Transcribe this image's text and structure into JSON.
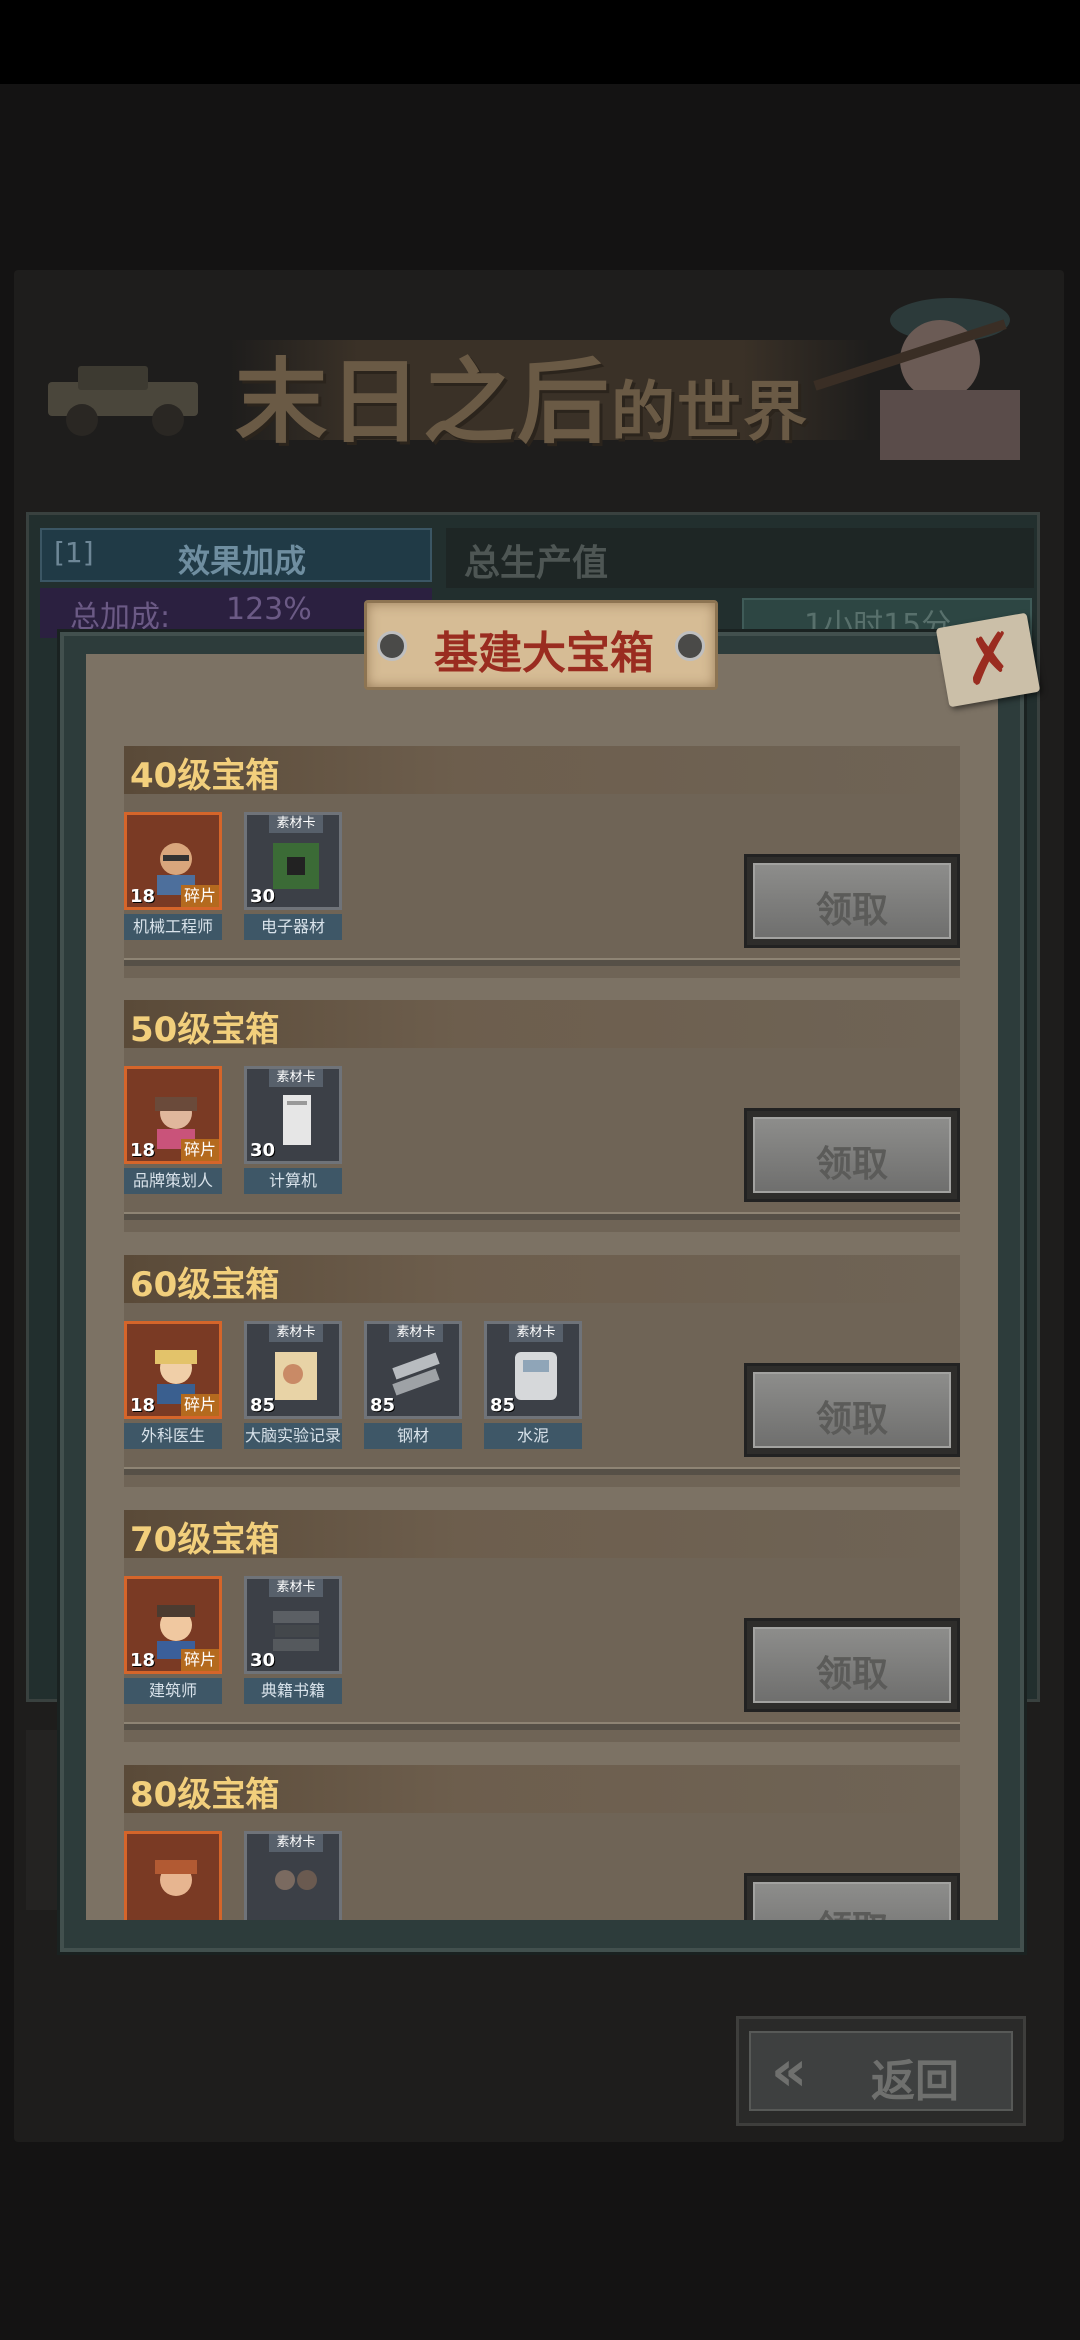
{
  "banner": {
    "title_main": "末日之后",
    "title_small": "的世界"
  },
  "background_panel": {
    "effect_tab_index": "[1]",
    "effect_tab_label": "效果加成",
    "total_bonus_label": "总加成:",
    "total_bonus_value": "123%",
    "total_output_label": "总生产值",
    "time_text": "1小时15分"
  },
  "modal": {
    "title": "基建大宝箱",
    "close_symbol": "✗",
    "claim_label": "领取",
    "hero_tag": "碎片",
    "card_tag": "素材卡",
    "sections": [
      {
        "title": "40级宝箱",
        "items": [
          {
            "name": "机械工程师",
            "count": "18",
            "kind": "hero",
            "icon": "engineer-portrait"
          },
          {
            "name": "电子器材",
            "count": "30",
            "kind": "card",
            "icon": "circuit-chip"
          }
        ]
      },
      {
        "title": "50级宝箱",
        "items": [
          {
            "name": "品牌策划人",
            "count": "18",
            "kind": "hero",
            "icon": "planner-portrait"
          },
          {
            "name": "计算机",
            "count": "30",
            "kind": "card",
            "icon": "computer-tower"
          }
        ]
      },
      {
        "title": "60级宝箱",
        "items": [
          {
            "name": "外科医生",
            "count": "18",
            "kind": "hero",
            "icon": "surgeon-portrait"
          },
          {
            "name": "大脑实验记录",
            "count": "85",
            "kind": "card",
            "icon": "brain-notes"
          },
          {
            "name": "钢材",
            "count": "85",
            "kind": "card",
            "icon": "steel-plates"
          },
          {
            "name": "水泥",
            "count": "85",
            "kind": "card",
            "icon": "cement-bag"
          }
        ]
      },
      {
        "title": "70级宝箱",
        "items": [
          {
            "name": "建筑师",
            "count": "18",
            "kind": "hero",
            "icon": "architect-portrait"
          },
          {
            "name": "典籍书籍",
            "count": "30",
            "kind": "card",
            "icon": "book-stack"
          }
        ]
      },
      {
        "title": "80级宝箱",
        "items": [
          {
            "name": "",
            "count": "",
            "kind": "hero",
            "icon": "hero-portrait"
          },
          {
            "name": "",
            "count": "",
            "kind": "card",
            "icon": "pipes"
          }
        ]
      }
    ]
  },
  "back_button": {
    "label": "返回"
  },
  "colors": {
    "section_title": "#f2cf7c",
    "modal_title": "#9a2c20",
    "hero_border": "#d5652a",
    "name_bar": "#3e5767"
  }
}
